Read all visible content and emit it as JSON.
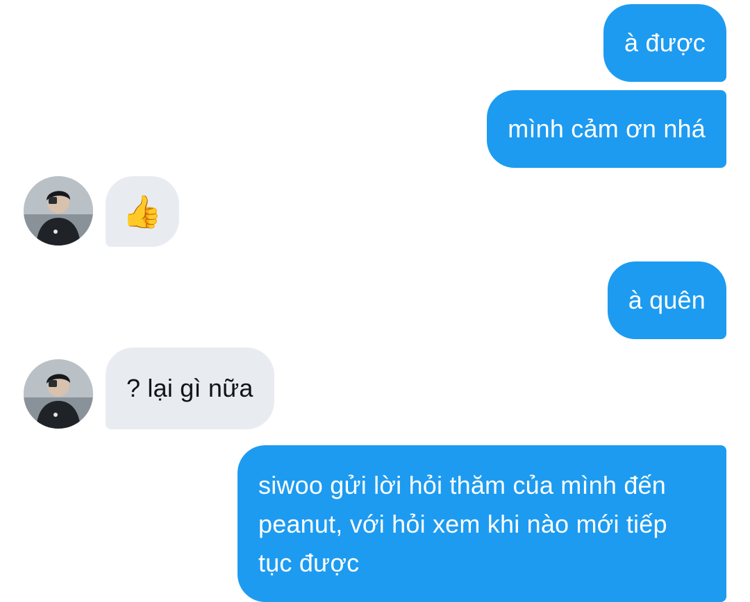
{
  "messages": [
    {
      "side": "out",
      "text": "à được"
    },
    {
      "side": "out",
      "text": "mình cảm ơn nhá"
    },
    {
      "side": "in",
      "text": "👍",
      "emoji_name": "thumbs-up"
    },
    {
      "side": "out",
      "text": "à quên"
    },
    {
      "side": "in",
      "text": "? lại gì nữa"
    },
    {
      "side": "out",
      "text": "siwoo gửi lời hỏi thăm của mình đến peanut, với hỏi xem khi nào mới tiếp tục được"
    }
  ],
  "colors": {
    "outgoing_bubble": "#1d9bf0",
    "incoming_bubble": "#e8ecf0",
    "outgoing_text": "#ffffff",
    "incoming_text": "#0f1419"
  }
}
